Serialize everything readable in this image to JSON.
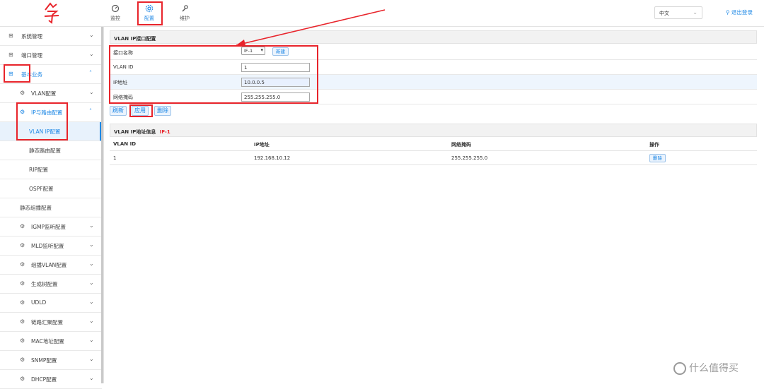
{
  "topbar": {
    "nav": [
      {
        "label": "监控",
        "icon": "dashboard-icon"
      },
      {
        "label": "配置",
        "icon": "gear-icon"
      },
      {
        "label": "维护",
        "icon": "wrench-icon"
      }
    ],
    "language": "中文",
    "logout": "退出登录"
  },
  "sidebar": {
    "items": [
      {
        "label": "系统管理",
        "icon": "grid-icon"
      },
      {
        "label": "端口管理",
        "icon": "grid-icon"
      },
      {
        "label": "基本业务",
        "icon": "grid-icon"
      },
      {
        "label": "VLAN配置",
        "icon": "gear-icon"
      },
      {
        "label": "IP与路由配置",
        "icon": "gear-icon"
      },
      {
        "label": "VLAN IP配置"
      },
      {
        "label": "静态路由配置"
      },
      {
        "label": "RIP配置"
      },
      {
        "label": "OSPF配置"
      },
      {
        "label": "静态组播配置"
      },
      {
        "label": "IGMP监听配置",
        "icon": "gear-icon"
      },
      {
        "label": "MLD监听配置",
        "icon": "gear-icon"
      },
      {
        "label": "组播VLAN配置",
        "icon": "gear-icon"
      },
      {
        "label": "生成树配置",
        "icon": "gear-icon"
      },
      {
        "label": "UDLD",
        "icon": "gear-icon"
      },
      {
        "label": "链路汇聚配置",
        "icon": "gear-icon"
      },
      {
        "label": "MAC地址配置",
        "icon": "gear-icon"
      },
      {
        "label": "SNMP配置",
        "icon": "gear-icon"
      },
      {
        "label": "DHCP配置",
        "icon": "gear-icon"
      }
    ]
  },
  "form": {
    "title": "VLAN IP接口配置",
    "interface_label": "接口名称",
    "interface_value": "IF-1",
    "new_button": "新建",
    "vlan_label": "VLAN ID",
    "vlan_value": "1",
    "ip_label": "IP地址",
    "ip_value": "10.0.0.5",
    "mask_label": "网络掩码",
    "mask_value": "255.255.255.0",
    "refresh": "刷新",
    "apply": "应用",
    "delete": "删除"
  },
  "info": {
    "title": "VLAN IP地址信息",
    "title_tag": "IF-1",
    "columns": [
      "VLAN ID",
      "IP地址",
      "网络掩码",
      "操作"
    ],
    "rows": [
      {
        "vlan": "1",
        "ip": "192.168.10.12",
        "mask": "255.255.255.0",
        "action": "删除"
      }
    ]
  },
  "watermark": "什么值得买",
  "colors": {
    "accent": "#1e88e5",
    "annotation": "#e8242b",
    "header_bg": "#f2f2f2",
    "row_alt": "#eef5fd"
  }
}
